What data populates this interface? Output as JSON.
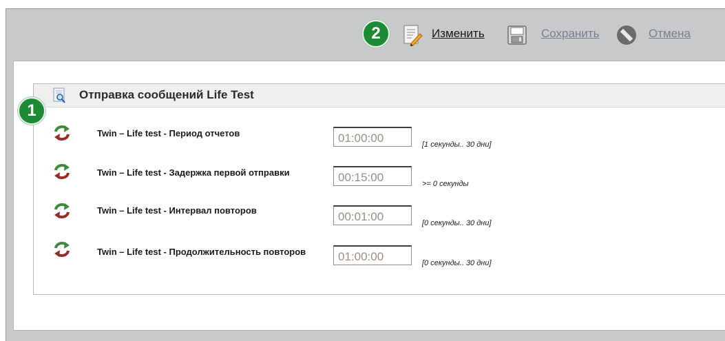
{
  "toolbar": {
    "step_badge": "2",
    "edit_label": "Изменить",
    "save_label": "Сохранить",
    "cancel_label": "Отмена"
  },
  "section": {
    "step_badge": "1",
    "title": "Отправка сообщений Life Test"
  },
  "rows": [
    {
      "label": "Twin – Life test - Период отчетов",
      "value": "01:00:00",
      "range": "[1 секунды.. 30 дни]"
    },
    {
      "label": "Twin – Life test - Задержка первой отправки",
      "value": "00:15:00",
      "range": ">= 0 секунды"
    },
    {
      "label": "Twin – Life test - Интервал повторов",
      "value": "00:01:00",
      "range": "[0 секунды.. 30 дни]"
    },
    {
      "label": "Twin – Life test - Продолжительность повторов",
      "value": "01:00:00",
      "range": "[0 секунды.. 30 дни]"
    }
  ],
  "colors": {
    "badge_green": "#1d8a36",
    "panel_gray": "#c8c9cb",
    "link_disabled": "#7b7f8c"
  },
  "icons": {
    "edit": "edit-document-icon",
    "save": "save-disk-icon",
    "cancel": "cancel-circle-icon",
    "section": "search-document-icon",
    "row": "refresh-arrows-icon"
  }
}
